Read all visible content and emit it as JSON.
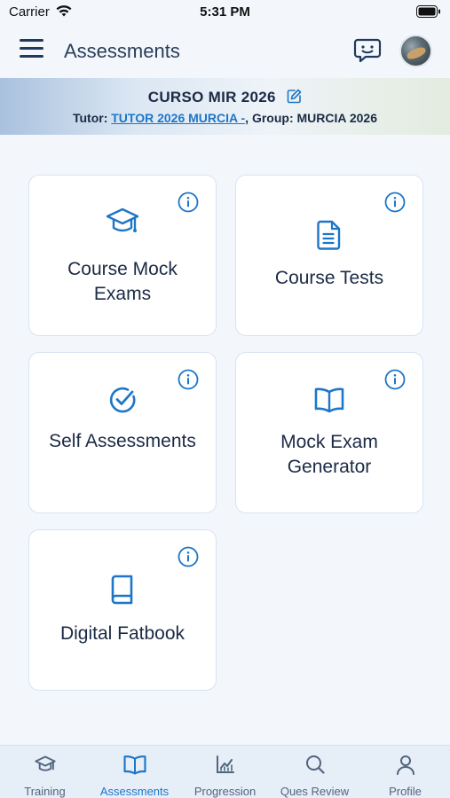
{
  "status_bar": {
    "carrier": "Carrier",
    "time": "5:31 PM"
  },
  "header": {
    "title": "Assessments"
  },
  "course": {
    "name": "CURSO MIR 2026",
    "tutor_prefix": "Tutor: ",
    "tutor_name": "TUTOR 2026 MURCIA -",
    "group_text": ", Group: MURCIA 2026"
  },
  "cards": [
    {
      "label": "Course Mock Exams",
      "icon": "graduation-cap-icon"
    },
    {
      "label": "Course Tests",
      "icon": "document-icon"
    },
    {
      "label": "Self Assessments",
      "icon": "check-circle-icon"
    },
    {
      "label": "Mock Exam Generator",
      "icon": "open-book-icon"
    },
    {
      "label": "Digital Fatbook",
      "icon": "book-icon"
    }
  ],
  "bottom_nav": [
    {
      "label": "Training",
      "icon": "graduation-cap-icon",
      "active": false
    },
    {
      "label": "Assessments",
      "icon": "open-book-icon",
      "active": true
    },
    {
      "label": "Progression",
      "icon": "chart-icon",
      "active": false
    },
    {
      "label": "Ques Review",
      "icon": "search-icon",
      "active": false
    },
    {
      "label": "Profile",
      "icon": "user-icon",
      "active": false
    }
  ],
  "colors": {
    "accent": "#1d76c8",
    "text": "#1b2a44",
    "nav_inactive": "#52657d",
    "background": "#f3f7fc"
  }
}
